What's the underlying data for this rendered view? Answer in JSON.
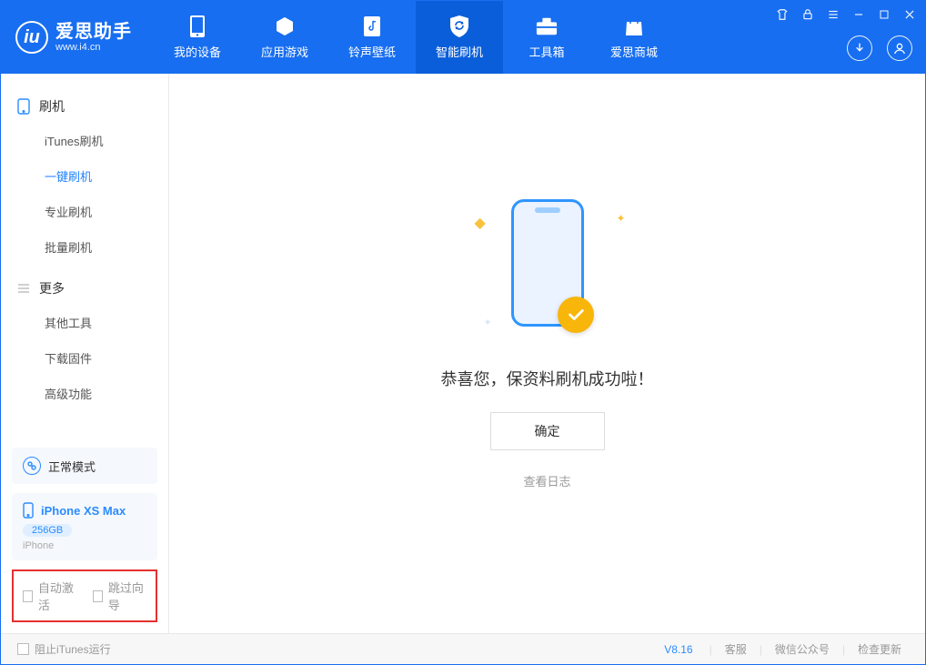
{
  "app": {
    "name": "爱思助手",
    "url": "www.i4.cn"
  },
  "tabs": [
    {
      "label": "我的设备"
    },
    {
      "label": "应用游戏"
    },
    {
      "label": "铃声壁纸"
    },
    {
      "label": "智能刷机"
    },
    {
      "label": "工具箱"
    },
    {
      "label": "爱思商城"
    }
  ],
  "sidebar": {
    "section1_title": "刷机",
    "section1_items": [
      "iTunes刷机",
      "一键刷机",
      "专业刷机",
      "批量刷机"
    ],
    "section1_active_index": 1,
    "section2_title": "更多",
    "section2_items": [
      "其他工具",
      "下载固件",
      "高级功能"
    ],
    "mode_label": "正常模式",
    "device": {
      "name": "iPhone XS Max",
      "capacity": "256GB",
      "type": "iPhone"
    },
    "checkbox1": "自动激活",
    "checkbox2": "跳过向导"
  },
  "main": {
    "success_text": "恭喜您，保资料刷机成功啦！",
    "ok_button": "确定",
    "view_log": "查看日志"
  },
  "statusbar": {
    "block_itunes": "阻止iTunes运行",
    "version": "V8.16",
    "links": [
      "客服",
      "微信公众号",
      "检查更新"
    ]
  }
}
